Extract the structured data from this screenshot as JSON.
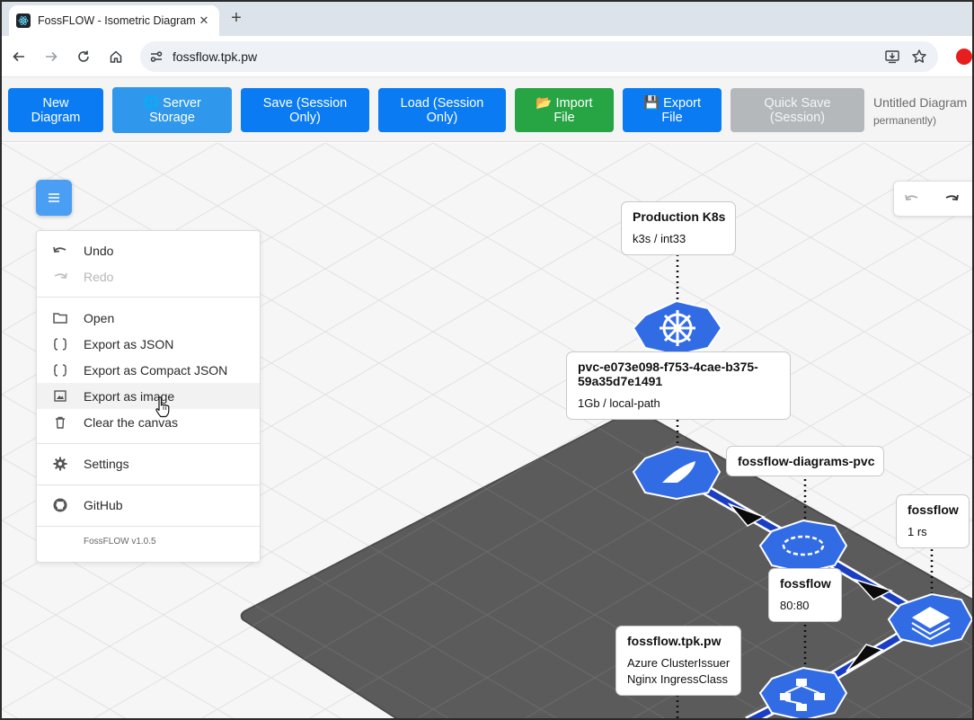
{
  "browser": {
    "tab_title": "FossFLOW - Isometric Diagram",
    "tab_close_glyph": "✕",
    "newtab_glyph": "+",
    "url": "fossflow.tpk.pw"
  },
  "appbar": {
    "buttons": [
      {
        "line1": "New",
        "line2": "Diagram"
      },
      {
        "line1": "🌐 Server",
        "line2": "Storage"
      },
      {
        "line1": "Save (Session",
        "line2": "Only)"
      },
      {
        "line1": "Load (Session",
        "line2": "Only)"
      },
      {
        "line1": "📂 Import",
        "line2": "File"
      },
      {
        "line1": "💾 Export",
        "line2": "File"
      },
      {
        "line1": "Quick Save",
        "line2": "(Session)"
      }
    ],
    "diagram_title": "Untitled Diagram",
    "diagram_subtitle": "permanently)"
  },
  "menu": {
    "items": [
      {
        "label": "Undo",
        "icon": "undo-icon",
        "enabled": true
      },
      {
        "label": "Redo",
        "icon": "redo-icon",
        "enabled": false
      },
      {
        "label": "Open",
        "icon": "folder-icon",
        "enabled": true
      },
      {
        "label": "Export as JSON",
        "icon": "braces-icon",
        "enabled": true
      },
      {
        "label": "Export as Compact JSON",
        "icon": "braces-icon",
        "enabled": true
      },
      {
        "label": "Export as image",
        "icon": "image-icon",
        "enabled": true,
        "hovered": true
      },
      {
        "label": "Clear the canvas",
        "icon": "trash-icon",
        "enabled": true
      },
      {
        "label": "Settings",
        "icon": "gear-icon",
        "enabled": true
      },
      {
        "label": "GitHub",
        "icon": "github-icon",
        "enabled": true
      }
    ],
    "version": "FossFLOW v1.0.5"
  },
  "labels": {
    "production": {
      "title": "Production K8s",
      "sub": "k3s / int33"
    },
    "pvc": {
      "title1": "pvc-e073e098-f753-4cae-b375-",
      "title2": "59a35d7e1491",
      "sub": "1Gb / local-path"
    },
    "diagrams_pvc": {
      "title": "fossflow-diagrams-pvc"
    },
    "fossflow_rs": {
      "title": "fossflow",
      "sub": "1 rs"
    },
    "fossflow_svc": {
      "title": "fossflow",
      "sub": "80:80"
    },
    "ingress": {
      "title": "fossflow.tpk.pw",
      "sub1": "Azure ClusterIssuer",
      "sub2": "Nginx IngressClass"
    }
  },
  "colors": {
    "primary": "#0a7bf2",
    "green": "#27a444",
    "disabled": "#b5b8bb",
    "node_blue": "#326ce5",
    "platform": "#5a5a5a",
    "connector": "#1a3fc4"
  }
}
